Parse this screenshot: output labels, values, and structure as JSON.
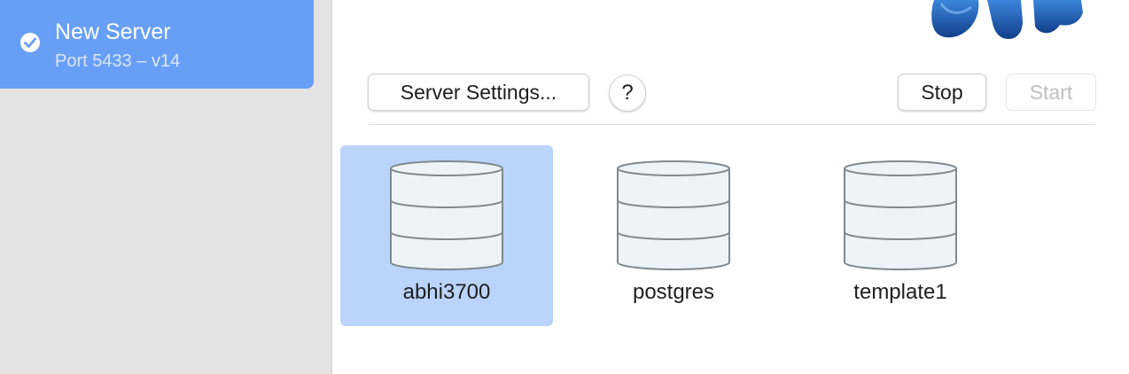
{
  "sidebar": {
    "server": {
      "name": "New Server",
      "subtitle": "Port 5433 – v14",
      "status_icon": "check-circle-icon"
    }
  },
  "toolbar": {
    "settings_label": "Server Settings...",
    "help_label": "?",
    "stop_label": "Stop",
    "start_label": "Start"
  },
  "databases": [
    {
      "name": "abhi3700",
      "icon": "database-icon",
      "selected": true
    },
    {
      "name": "postgres",
      "icon": "database-icon",
      "selected": false
    },
    {
      "name": "template1",
      "icon": "database-icon",
      "selected": false
    }
  ],
  "colors": {
    "accent": "#689ff6",
    "selection": "#bad4fb",
    "sidebar_bg": "#e3e3e3",
    "logo_blue": "#1f63b8"
  }
}
